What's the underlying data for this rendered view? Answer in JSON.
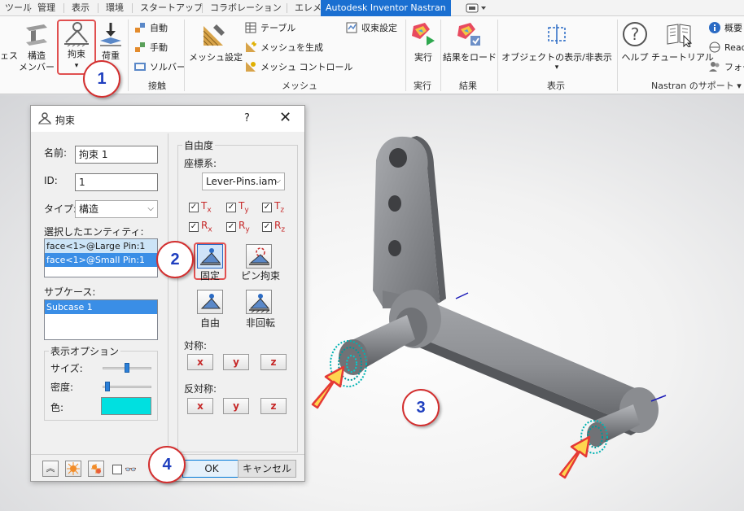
{
  "tabs": [
    "ツール",
    "管理",
    "表示",
    "環境",
    "スタートアップ",
    "コラボレーション",
    "エレメカ",
    "Autodesk Inventor Nastran"
  ],
  "active_tab_index": 7,
  "ribbon": {
    "partial_left_label": "ェス",
    "structural_member": "構造\nメンバー",
    "constraint": "拘束",
    "load": "荷重",
    "contact_group": {
      "auto": "自動",
      "manual": "手動",
      "solver": "ソルバー",
      "label": "接触"
    },
    "mesh_group": {
      "mesh_settings": "メッシュ設定",
      "table": "テーブル",
      "generate_mesh": "メッシュを生成",
      "mesh_control": "メッシュ コントロール",
      "convergence": "収束設定",
      "label": "メッシュ"
    },
    "run": "実行",
    "run_group": "実行",
    "load_results": "結果をロード",
    "results_group": "結果",
    "object_visibility": "オブジェクトの表示/非表示",
    "display_group": "表示",
    "help": "ヘルプ",
    "tutorial": "チュートリアル",
    "overview": "概要",
    "readme": "Read",
    "forum": "フォー",
    "support_group": "Nastran のサポート"
  },
  "dialog": {
    "title": "拘束",
    "help_glyph": "?",
    "close_glyph": "✕",
    "name_label": "名前:",
    "name_value": "拘束 1",
    "id_label": "ID:",
    "id_value": "1",
    "type_label": "タイプ:",
    "type_value": "構造",
    "entities_label": "選択したエンティティ:",
    "entities": [
      "face<1>@Large Pin:1",
      "face<1>@Small Pin:1"
    ],
    "subcase_label": "サブケース:",
    "subcases": [
      "Subcase 1"
    ],
    "display_options_label": "表示オプション",
    "size_label": "サイズ:",
    "size_level": 0.5,
    "density_label": "密度:",
    "density_level": 0.05,
    "color_label": "色:",
    "color_hex": "#00e0e0",
    "dof_label": "自由度",
    "coord_label": "座標系:",
    "coord_value": "Lever-Pins.iam",
    "dof": [
      {
        "base": "T",
        "sub": "x",
        "checked": true
      },
      {
        "base": "T",
        "sub": "y",
        "checked": true
      },
      {
        "base": "T",
        "sub": "z",
        "checked": true
      },
      {
        "base": "R",
        "sub": "x",
        "checked": true
      },
      {
        "base": "R",
        "sub": "y",
        "checked": true
      },
      {
        "base": "R",
        "sub": "z",
        "checked": true
      }
    ],
    "fixed": "固定",
    "pin": "ピン拘束",
    "free": "自由",
    "no_rotation": "非回転",
    "symmetry_label": "対称:",
    "antisymmetry_label": "反対称:",
    "axes": [
      "x",
      "y",
      "z"
    ],
    "ok": "OK",
    "cancel": "キャンセル",
    "glasses_glyph": "👓"
  },
  "callouts": [
    "1",
    "2",
    "3",
    "4"
  ],
  "colors": {
    "accent": "#1a6fd1",
    "callout_border": "#d32f2f",
    "callout_text": "#1f3fbf",
    "part_gray": "#8e9094",
    "mesh_cyan": "#00b3b3",
    "arrow_yellow": "#ffd54f"
  }
}
